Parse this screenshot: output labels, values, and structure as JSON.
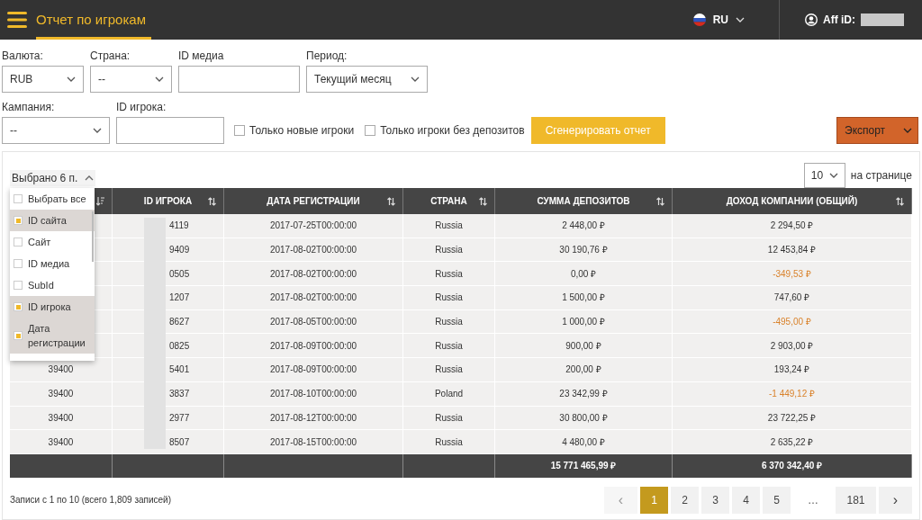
{
  "header": {
    "title": "Отчет по игрокам",
    "language": "RU",
    "aff_label": "Aff iD:",
    "aff_redacted": true
  },
  "filters_top": [
    {
      "label": "Валюта:",
      "kind": "select",
      "value": "RUB"
    },
    {
      "label": "Страна:",
      "kind": "select",
      "value": "--"
    },
    {
      "label": "ID медиа",
      "kind": "input"
    },
    {
      "label": "Период:",
      "kind": "select",
      "value": "Текущий месяц"
    }
  ],
  "filters_bottom": [
    {
      "label": "Кампания:",
      "kind": "select",
      "value": "--"
    },
    {
      "label": "ID игрока:",
      "kind": "input"
    }
  ],
  "checkboxes": [
    {
      "label": "Только новые игроки",
      "checked": false
    },
    {
      "label": "Только игроки без депозитов",
      "checked": false
    }
  ],
  "generate_button": "Сгенерировать отчет",
  "export_button": "Экспорт",
  "column_chooser": {
    "label": "Выбрано 6 п.",
    "expanded": true,
    "options": [
      {
        "label": "Выбрать все",
        "checked": false
      },
      {
        "label": "ID сайта",
        "checked": true
      },
      {
        "label": "Сайт",
        "checked": false
      },
      {
        "label": "ID медиа",
        "checked": false
      },
      {
        "label": "SubId",
        "checked": false
      },
      {
        "label": "ID игрока",
        "checked": true
      },
      {
        "label": "Дата регистрации",
        "checked": true
      }
    ]
  },
  "per_page": {
    "value": "10",
    "label": "на странице"
  },
  "table": {
    "player_id_redacted": true,
    "columns": [
      {
        "sorted": true
      },
      {
        "label": "ID ИГРОКА",
        "sorted": false
      },
      {
        "label": "ДАТА РЕГИСТРАЦИИ",
        "sorted": false
      },
      {
        "label": "СТРАНА",
        "sorted": false
      },
      {
        "label": "СУММА ДЕПОЗИТОВ",
        "sorted": false
      },
      {
        "label": "ДОХОД КОМПАНИИ (ОБЩИЙ)",
        "sorted": false
      }
    ],
    "rows": [
      {
        "player_id": "4119",
        "date": "2017-07-25T00:00:00",
        "country": "Russia",
        "deposits": "2 448,00 ₽",
        "revenue": "2 294,50 ₽",
        "negative": false
      },
      {
        "player_id": "9409",
        "date": "2017-08-02T00:00:00",
        "country": "Russia",
        "deposits": "30 190,76 ₽",
        "revenue": "12 453,84 ₽",
        "negative": false
      },
      {
        "player_id": "0505",
        "date": "2017-08-02T00:00:00",
        "country": "Russia",
        "deposits": "0,00 ₽",
        "revenue": "-349,53 ₽",
        "negative": true
      },
      {
        "player_id": "1207",
        "date": "2017-08-02T00:00:00",
        "country": "Russia",
        "deposits": "1 500,00 ₽",
        "revenue": "747,60 ₽",
        "negative": false
      },
      {
        "player_id": "8627",
        "date": "2017-08-05T00:00:00",
        "country": "Russia",
        "deposits": "1 000,00 ₽",
        "revenue": "-495,00 ₽",
        "negative": true
      },
      {
        "player_id": "0825",
        "date": "2017-08-09T00:00:00",
        "country": "Russia",
        "deposits": "900,00 ₽",
        "revenue": "2 903,00 ₽",
        "negative": false
      },
      {
        "column_1": "39400",
        "player_id": "5401",
        "date": "2017-08-09T00:00:00",
        "country": "Russia",
        "deposits": "200,00 ₽",
        "revenue": "193,24 ₽",
        "negative": false
      },
      {
        "column_1": "39400",
        "player_id": "3837",
        "date": "2017-08-10T00:00:00",
        "country": "Poland",
        "deposits": "23 342,99 ₽",
        "revenue": "-1 449,12 ₽",
        "negative": true
      },
      {
        "column_1": "39400",
        "player_id": "2977",
        "date": "2017-08-12T00:00:00",
        "country": "Russia",
        "deposits": "30 800,00 ₽",
        "revenue": "23 722,25 ₽",
        "negative": false
      },
      {
        "column_1": "39400",
        "player_id": "8507",
        "date": "2017-08-15T00:00:00",
        "country": "Russia",
        "deposits": "4 480,00 ₽",
        "revenue": "2 635,22 ₽",
        "negative": false
      }
    ],
    "totals": {
      "deposits": "15 771 465,99 ₽",
      "revenue": "6 370 342,40 ₽"
    }
  },
  "status": "Записи с 1 по 10 (всего 1,809 записей)",
  "pagination": [
    {
      "label": "‹",
      "kind": "prev",
      "disabled": true,
      "selected": false
    },
    {
      "label": "1",
      "kind": "page",
      "selected": true
    },
    {
      "label": "2",
      "kind": "page",
      "selected": false
    },
    {
      "label": "3",
      "kind": "page",
      "selected": false
    },
    {
      "label": "4",
      "kind": "page",
      "selected": false
    },
    {
      "label": "5",
      "kind": "page",
      "selected": false
    },
    {
      "label": "…",
      "kind": "ellipsis"
    },
    {
      "label": "181",
      "kind": "page",
      "selected": false
    },
    {
      "label": "›",
      "kind": "next",
      "disabled": false,
      "selected": false
    }
  ]
}
